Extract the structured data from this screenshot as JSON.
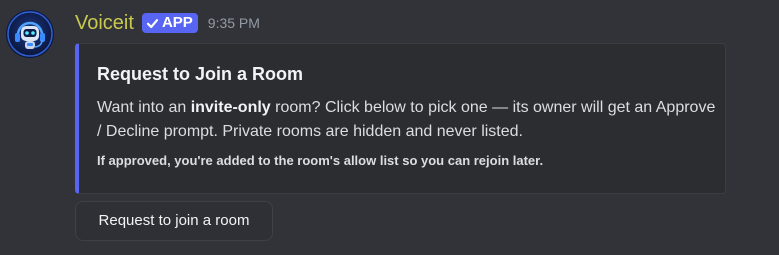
{
  "author": {
    "name": "Voiceit",
    "avatar_icon": "robot-headset-icon",
    "name_color": "#c9c94d"
  },
  "badge": {
    "label": "APP",
    "icon": "checkmark-icon",
    "color": "#5865f2"
  },
  "timestamp": "9:35 PM",
  "embed": {
    "accent_color": "#5865f2",
    "title": "Request to Join a Room",
    "description": {
      "prefix": "Want into an ",
      "emphasis": "invite-only",
      "suffix": " room? Click below to pick one — its owner will get an Approve / Decline prompt. Private rooms are hidden and never listed."
    },
    "footer": "If approved, you're added to the room's allow list so you can rejoin later."
  },
  "button": {
    "label": "Request to join a room"
  }
}
